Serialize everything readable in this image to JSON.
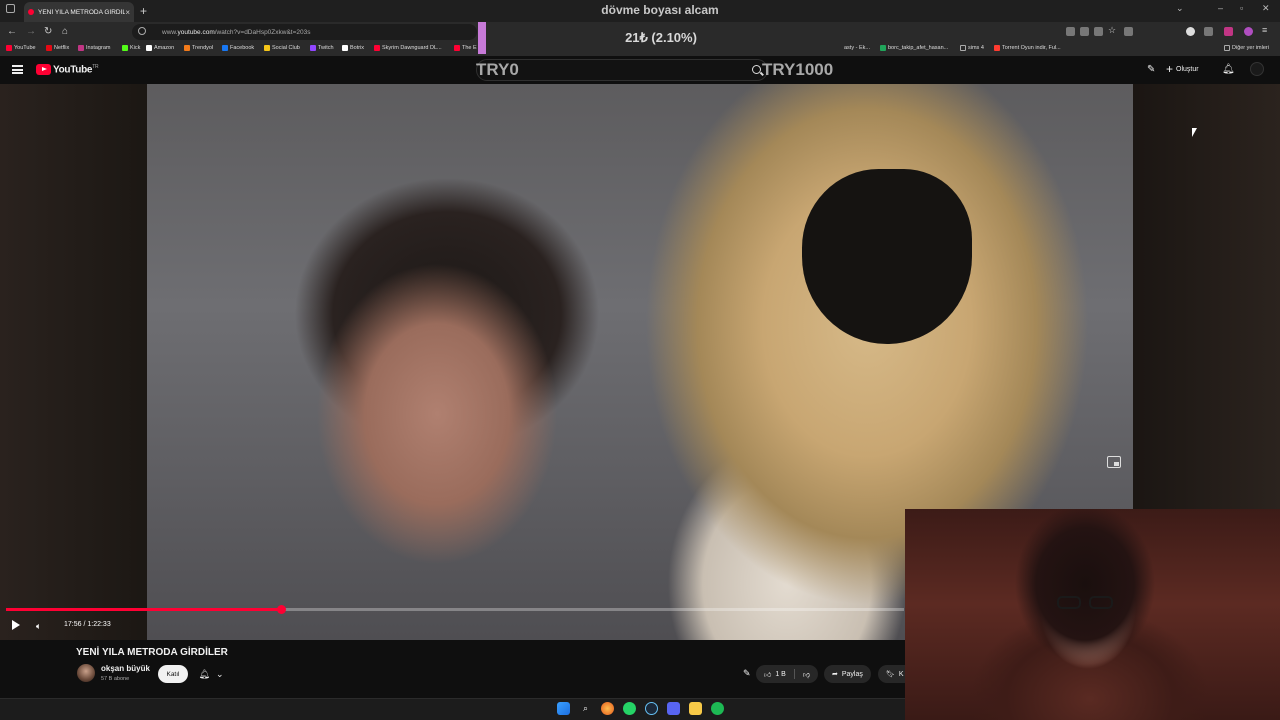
{
  "browser": {
    "tab_title": "YENİ YILA METRODA GİRDİLER",
    "url_prefix": "www.",
    "url_domain": "youtube.com",
    "url_rest": "/watch?v=dDaHsp0Zxkw&t=203s",
    "bookmarks": [
      {
        "label": "YouTube",
        "color": "#ff0033"
      },
      {
        "label": "Netflix",
        "color": "#e50914"
      },
      {
        "label": "Instagram",
        "color": "#c13584"
      },
      {
        "label": "Kick",
        "color": "#53fc18"
      },
      {
        "label": "Amazon",
        "color": "#ffffff"
      },
      {
        "label": "Trendyol",
        "color": "#f27a1a"
      },
      {
        "label": "Facebook",
        "color": "#1877f2"
      },
      {
        "label": "Social Club",
        "color": "#f5c518"
      },
      {
        "label": "Twitch",
        "color": "#9146ff"
      },
      {
        "label": "Botrix",
        "color": "#ffffff"
      },
      {
        "label": "Skyrim Dawnguard DL...",
        "color": "#ff0033"
      },
      {
        "label": "The E",
        "color": "#ff0033"
      },
      {
        "label": "asty - Ek...",
        "color": "#888888"
      },
      {
        "label": "borc_takip_afet_hasan...",
        "color": "#20a55a"
      },
      {
        "label": "sims 4",
        "color": "#aaaaaa"
      },
      {
        "label": "Torrent Oyun indir, Ful...",
        "color": "#ff3b30"
      },
      {
        "label": "Diğer yer imleri",
        "color": "#aaaaaa"
      }
    ]
  },
  "overlay": {
    "goal_title": "dövme boyası alcam",
    "goal_value": "21₺ (2.10%)",
    "goal_fraction": 0.021,
    "goal_min": "TRY0",
    "goal_max": "TRY1000",
    "accent": "#c77ad8"
  },
  "youtube": {
    "logo_text": "YouTube",
    "logo_region": "TR",
    "create_label": "Oluştur",
    "brand_color": "#ff0033"
  },
  "player": {
    "current_time": "17:56",
    "duration": "1:22:33",
    "time_display": "17:56 / 1:22:33",
    "progress_fraction": 0.306
  },
  "video": {
    "title": "YENİ YILA METRODA GİRDİLER",
    "channel_name": "okşan büyük",
    "subscribers": "57 B abone",
    "join_label": "Katıl",
    "likes": "1 B",
    "share_label": "Paylaş",
    "save_label": "K"
  }
}
